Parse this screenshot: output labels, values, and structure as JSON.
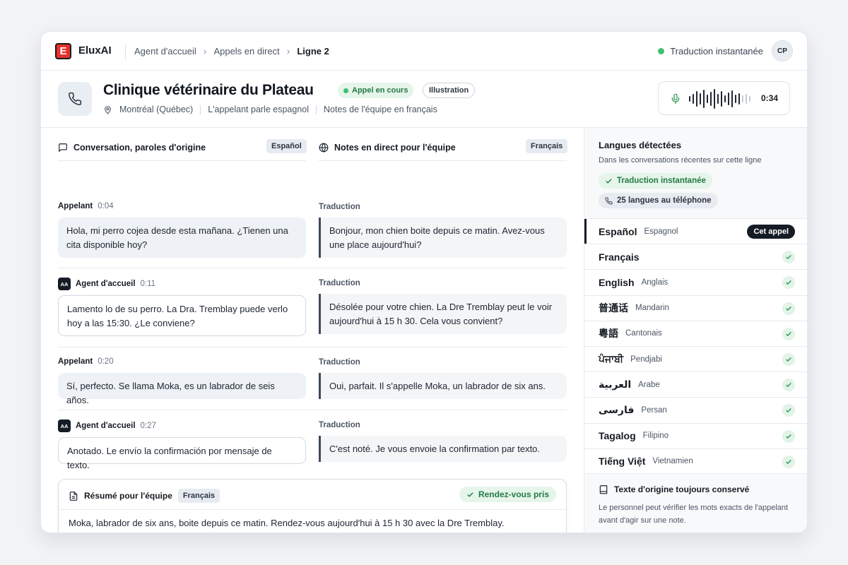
{
  "app": {
    "name": "EluxAI",
    "logo_letter": "E"
  },
  "breadcrumb": {
    "items": [
      "Agent d'accueil",
      "Appels en direct"
    ],
    "current": "Ligne 2"
  },
  "top_status": {
    "label": "Traduction instantanée",
    "user_initials": "CP"
  },
  "header": {
    "title": "Clinique vétérinaire du Plateau",
    "live_badge": "Appel en cours",
    "tag_badge": "Illustration",
    "location": "Montréal (Québec)",
    "caller_lang_note": "L'appelant parle espagnol",
    "team_lang_note": "Notes de l'équipe en français",
    "call_timer": "0:34"
  },
  "columns": {
    "original_title": "Conversation, paroles d'origine",
    "original_lang": "Español",
    "live_title": "Notes en direct pour l'équipe",
    "live_lang": "Français",
    "translation_label": "Traduction"
  },
  "messages": [
    {
      "speaker": "Appelant",
      "time": "0:04",
      "original": "Hola, mi perro cojea desde esta mañana. ¿Tienen una cita disponible hoy?",
      "translation": "Bonjour, mon chien boite depuis ce matin. Avez-vous une place aujourd'hui?"
    },
    {
      "speaker": "Agent d'accueil",
      "badge": "AA",
      "time": "0:11",
      "original": "Lamento lo de su perro. La Dra. Tremblay puede verlo hoy a las 15:30. ¿Le conviene?",
      "translation": "Désolée pour votre chien. La Dre Tremblay peut le voir aujourd'hui à 15 h 30. Cela vous convient?"
    },
    {
      "speaker": "Appelant",
      "time": "0:20",
      "original": "Sí, perfecto. Se llama Moka, es un labrador de seis años.",
      "translation": "Oui, parfait. Il s'appelle Moka, un labrador de six ans."
    },
    {
      "speaker": "Agent d'accueil",
      "badge": "AA",
      "time": "0:27",
      "original": "Anotado. Le envío la confirmación por mensaje de texto.",
      "translation": "C'est noté. Je vous envoie la confirmation par texto."
    }
  ],
  "summary": {
    "title": "Résumé pour l'équipe",
    "lang": "Français",
    "status": "Rendez-vous pris",
    "text": "Moka, labrador de six ans, boite depuis ce matin. Rendez-vous aujourd'hui à 15 h 30 avec la Dre Tremblay. Confirmation texto envoyée."
  },
  "sidebar": {
    "title": "Langues détectées",
    "subtitle": "Dans les conversations récentes sur cette ligne",
    "pill_instant": "Traduction instantanée",
    "pill_phone": "25 langues au téléphone",
    "this_call_label": "Cet appel",
    "languages": [
      {
        "native": "Español",
        "fr": "Espagnol",
        "active": true
      },
      {
        "native": "Français",
        "fr": ""
      },
      {
        "native": "English",
        "fr": "Anglais"
      },
      {
        "native": "普通话",
        "fr": "Mandarin"
      },
      {
        "native": "粵語",
        "fr": "Cantonais"
      },
      {
        "native": "ਪੰਜਾਬੀ",
        "fr": "Pendjabi"
      },
      {
        "native": "العربية",
        "fr": "Arabe"
      },
      {
        "native": "فارسی",
        "fr": "Persan"
      },
      {
        "native": "Tagalog",
        "fr": "Filipino"
      },
      {
        "native": "Tiếng Việt",
        "fr": "Vietnamien"
      }
    ],
    "footer_title": "Texte d'origine toujours conservé",
    "footer_text": "Le personnel peut vérifier les mots exacts de l'appelant avant d'agir sur une note."
  },
  "colors": {
    "accent_dark": "#161c26",
    "brand_red": "#e5322c",
    "success": "#237a45",
    "success_bg": "#e5f5ea"
  }
}
